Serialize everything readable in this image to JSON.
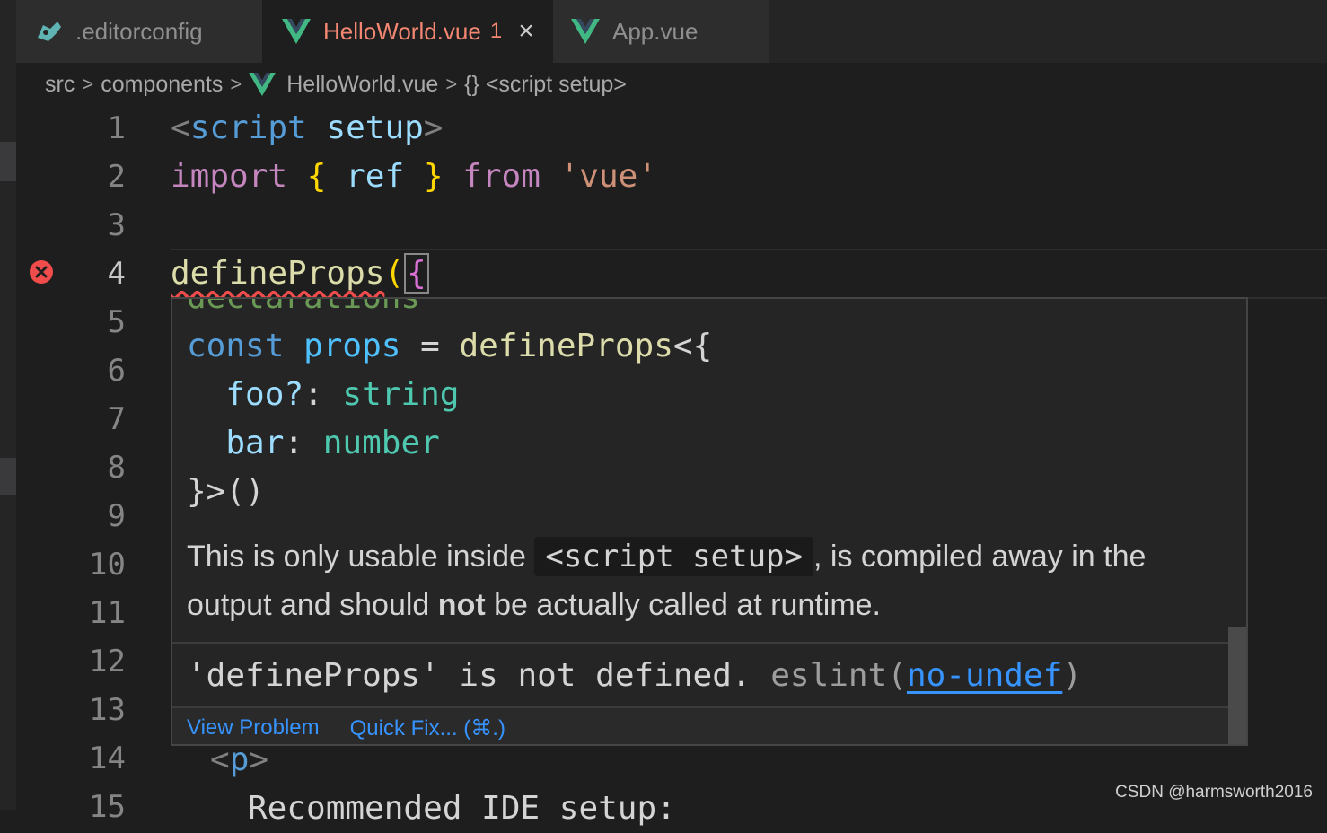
{
  "tabs": [
    {
      "label": ".editorconfig",
      "icon": "editorconfig-icon"
    },
    {
      "label": "HelloWorld.vue",
      "badge": "1",
      "icon": "vue-icon",
      "active": true
    },
    {
      "label": "App.vue",
      "icon": "vue-icon"
    }
  ],
  "breadcrumb": {
    "src": "src",
    "components": "components",
    "file": "HelloWorld.vue",
    "symbol": "{} <script setup>"
  },
  "line_numbers": [
    "1",
    "2",
    "3",
    "4",
    "5",
    "6",
    "7",
    "8",
    "9",
    "10",
    "11",
    "12",
    "13",
    "14",
    "15"
  ],
  "code": {
    "l1_open": "<",
    "l1_tag": "script",
    "l1_attr": "setup",
    "l1_close": ">",
    "l2_import": "import",
    "l2_lbrace": "{",
    "l2_ref": "ref",
    "l2_rbrace": "}",
    "l2_from": "from",
    "l2_str": "'vue'",
    "l4_fn": "defineProps",
    "l4_paren": "(",
    "l4_brace": "{",
    "l14_open": "<",
    "l14_tag": "p",
    "l14_close": ">",
    "l15_text": "Recommended IDE setup:"
  },
  "hover": {
    "comment": "declarations",
    "c1_const": "const",
    "c1_props": "props",
    "c1_eq": " = ",
    "c1_fn": "defineProps",
    "c1_tail": "<{",
    "c2_prop": "foo?",
    "c2_colon": ": ",
    "c2_type": "string",
    "c3_prop": "bar",
    "c3_colon": ": ",
    "c3_type": "number",
    "c4": "}>()",
    "desc_pre": "This is only usable inside ",
    "desc_code": "<script setup>",
    "desc_mid": ", is compiled away in the output and should ",
    "desc_bold": "not",
    "desc_post": " be actually called at runtime.",
    "diag_msg": "'defineProps' is not defined.",
    "diag_src": " eslint(",
    "diag_rule": "no-undef",
    "diag_end": ")",
    "view_problem": "View Problem",
    "quick_fix": "Quick Fix... (⌘.)"
  },
  "watermark": "CSDN @harmsworth2016",
  "colors": {
    "editor_bg": "#1e1e1e",
    "tab_active_error": "#f48771",
    "vue_green": "#41b883",
    "error_red": "#f14c4c",
    "link_blue": "#3794ff"
  }
}
